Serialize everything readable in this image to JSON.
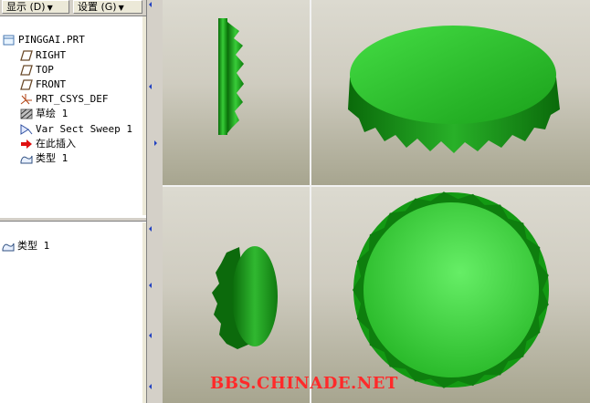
{
  "toolbar": {
    "display_label": "显示 (D)",
    "settings_label": "设置 (G)"
  },
  "model_tree": {
    "items": [
      {
        "label": "PINGGAI.PRT",
        "icon": "part-icon"
      },
      {
        "label": "RIGHT",
        "icon": "datum-plane-icon"
      },
      {
        "label": "TOP",
        "icon": "datum-plane-icon"
      },
      {
        "label": "FRONT",
        "icon": "datum-plane-icon"
      },
      {
        "label": "PRT_CSYS_DEF",
        "icon": "coordinate-system-icon"
      },
      {
        "label": "草绘 1",
        "icon": "sketch-icon"
      },
      {
        "label": "Var Sect Sweep 1",
        "icon": "sweep-icon"
      },
      {
        "label": "在此插入",
        "icon": "insert-here-arrow-icon"
      },
      {
        "label": "类型 1",
        "icon": "style-feature-icon"
      }
    ]
  },
  "lower_panel": {
    "items": [
      {
        "label": "类型 1",
        "icon": "style-feature-icon"
      }
    ]
  },
  "watermark": "BBS.CHINADE.NET",
  "colors": {
    "cap_green": "#22b322",
    "cap_dark": "#0a6a0a",
    "cap_light": "#66ee66",
    "viewport_bg": "#cfccc0",
    "watermark": "#ff2a2a"
  }
}
